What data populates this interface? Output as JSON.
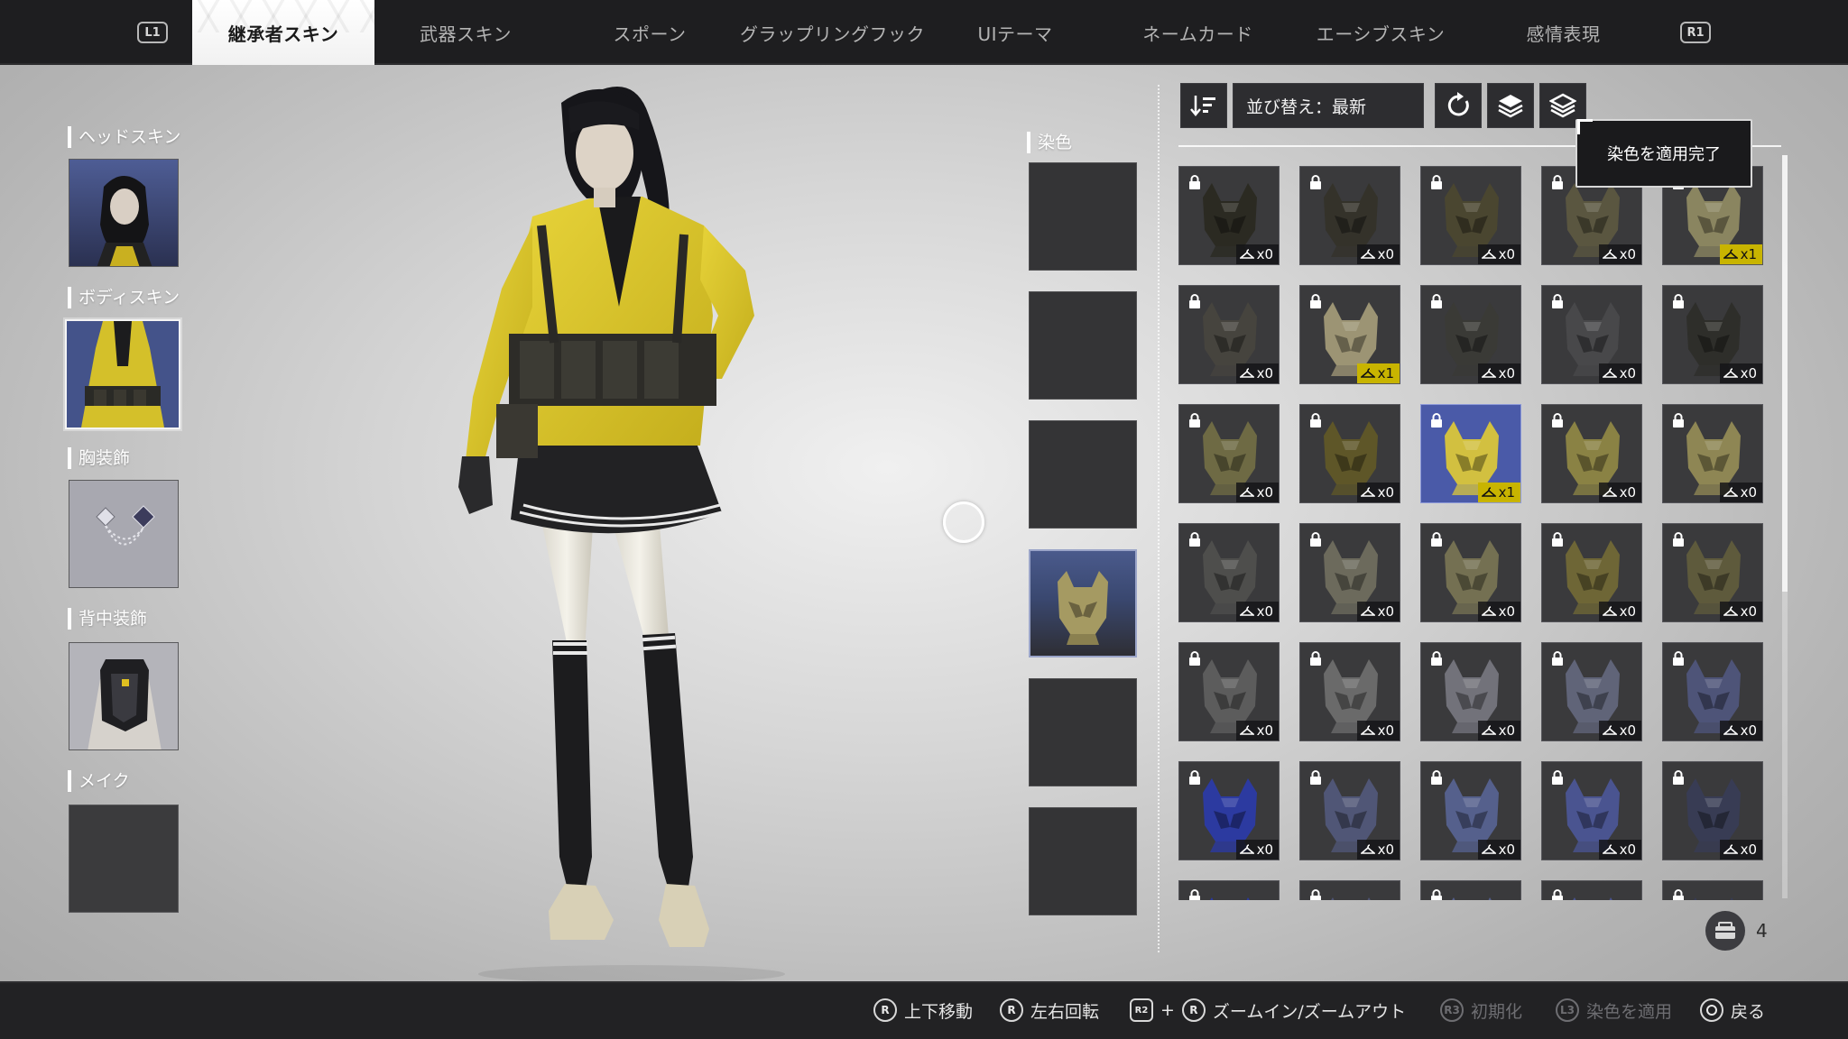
{
  "topbar": {
    "l1": "L1",
    "r1": "R1",
    "tabs": [
      {
        "label": "継承者スキン"
      },
      {
        "label": "武器スキン"
      },
      {
        "label": "スポーン"
      },
      {
        "label": "グラップリングフック"
      },
      {
        "label": "UIテーマ"
      },
      {
        "label": "ネームカード"
      },
      {
        "label": "エーシブスキン"
      },
      {
        "label": "感情表現"
      }
    ],
    "active_tab": "継承者スキン"
  },
  "left_panel": {
    "sections": [
      {
        "label": "ヘッドスキン"
      },
      {
        "label": "ボディスキン"
      },
      {
        "label": "胸装飾"
      },
      {
        "label": "背中装飾"
      },
      {
        "label": "メイク"
      }
    ]
  },
  "dye": {
    "label": "染色",
    "selected_slot": 4
  },
  "toolbar": {
    "sort_label": "並び替え：最新",
    "icons": [
      "sort-order-icon",
      "reset-icon",
      "layers-icon",
      "layers-alt-icon"
    ]
  },
  "tooltip": "染色を適用完了",
  "grid": {
    "rows": [
      [
        {
          "count": "x0"
        },
        {
          "count": "x0"
        },
        {
          "count": "x0"
        },
        {
          "count": "x0"
        },
        {
          "count": "x1",
          "owned": true
        }
      ],
      [
        {
          "count": "x0"
        },
        {
          "count": "x1",
          "owned": true
        },
        {
          "count": "x0"
        },
        {
          "count": "x0"
        },
        {
          "count": "x0"
        }
      ],
      [
        {
          "count": "x0"
        },
        {
          "count": "x0"
        },
        {
          "count": "x1",
          "owned": true
        },
        {
          "count": "x0"
        },
        {
          "count": "x0"
        }
      ],
      [
        {
          "count": "x0"
        },
        {
          "count": "x0"
        },
        {
          "count": "x0"
        },
        {
          "count": "x0"
        },
        {
          "count": "x0"
        }
      ],
      [
        {
          "count": "x0"
        },
        {
          "count": "x0"
        },
        {
          "count": "x0"
        },
        {
          "count": "x0"
        },
        {
          "count": "x0"
        }
      ],
      [
        {
          "count": "x0"
        },
        {
          "count": "x0"
        },
        {
          "count": "x0"
        },
        {
          "count": "x0"
        },
        {
          "count": "x0"
        }
      ]
    ],
    "colors": [
      [
        "#2b2a22",
        "#34322a",
        "#4a4630",
        "#5a5640",
        "#8a8560"
      ],
      [
        "#46443e",
        "#9c9474",
        "#3a3a36",
        "#48484a",
        "#2e2e2a"
      ],
      [
        "#6e6a44",
        "#5e5628",
        "#d2c040",
        "#8a8244",
        "#8e8654"
      ],
      [
        "#4e4e4c",
        "#6c6a5c",
        "#747052",
        "#6e6636",
        "#5e5a3c"
      ],
      [
        "#5c5c5c",
        "#6a6a6a",
        "#72727a",
        "#606478",
        "#4e5478"
      ],
      [
        "#2c3aa0",
        "#505676",
        "#55608c",
        "#4a5490",
        "#383c54"
      ]
    ],
    "active_cell": [
      2,
      2
    ],
    "storage_count": "4"
  },
  "hints": [
    {
      "glyph": "R",
      "label": "上下移動"
    },
    {
      "glyph": "R",
      "label": "左右回転"
    },
    {
      "glyph": "R2",
      "plus": "+",
      "glyph2": "R",
      "label": "ズームイン/ズームアウト"
    },
    {
      "glyph": "R3",
      "label": "初期化",
      "dim": true
    },
    {
      "glyph": "L3",
      "label": "染色を適用",
      "dim": true
    },
    {
      "glyph": "",
      "label": "戻る"
    }
  ]
}
